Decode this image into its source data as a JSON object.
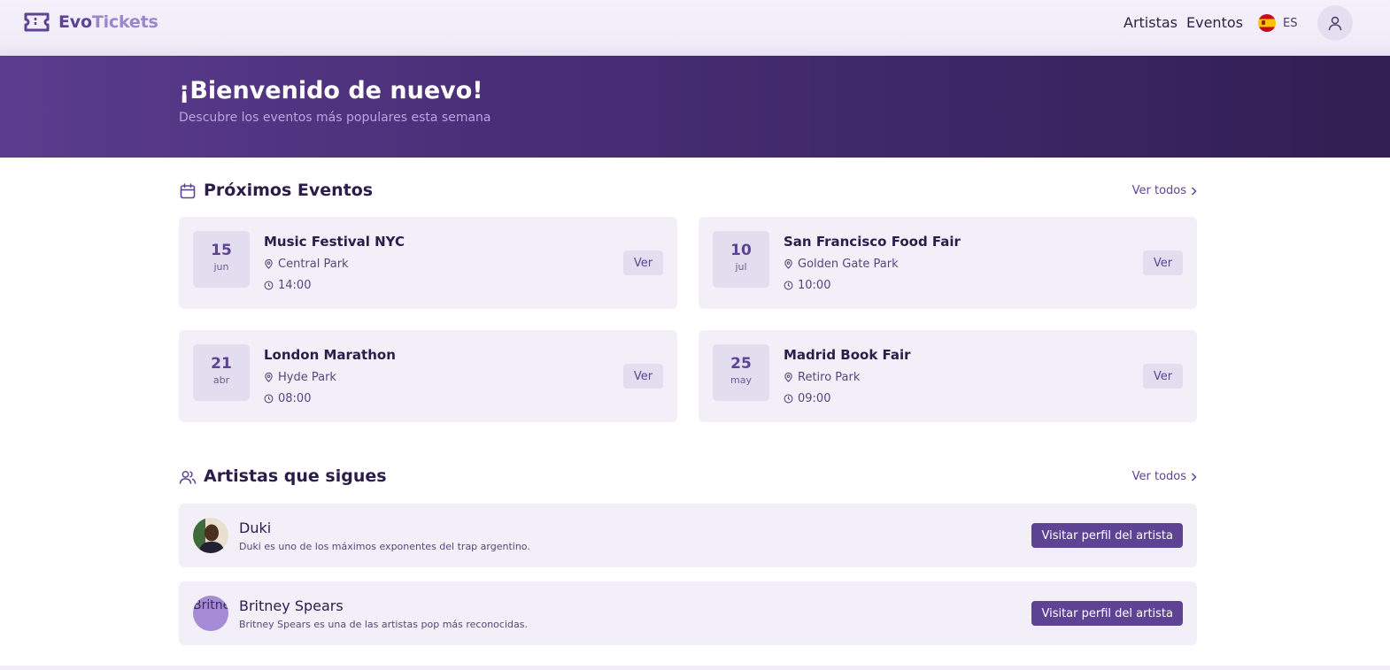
{
  "brand": {
    "name_part1": "Evo",
    "name_part2": "Tickets",
    "icon": "ticket-icon"
  },
  "nav": {
    "artists": "Artistas",
    "events": "Eventos",
    "language_code": "ES",
    "language_flag": "spain-flag-icon",
    "profile_icon": "user-icon"
  },
  "hero": {
    "title": "¡Bienvenido de nuevo!",
    "subtitle": "Descubre los eventos más populares esta semana"
  },
  "upcoming": {
    "icon": "calendar-icon",
    "title": "Próximos Eventos",
    "see_all": "Ver todos",
    "events": [
      {
        "day": "15",
        "month": "jun",
        "name": "Music Festival NYC",
        "place": "Central Park",
        "time": "14:00",
        "action": "Ver"
      },
      {
        "day": "10",
        "month": "jul",
        "name": "San Francisco Food Fair",
        "place": "Golden Gate Park",
        "time": "10:00",
        "action": "Ver"
      },
      {
        "day": "21",
        "month": "abr",
        "name": "London Marathon",
        "place": "Hyde Park",
        "time": "08:00",
        "action": "Ver"
      },
      {
        "day": "25",
        "month": "may",
        "name": "Madrid Book Fair",
        "place": "Retiro Park",
        "time": "09:00",
        "action": "Ver"
      }
    ]
  },
  "artists": {
    "icon": "users-icon",
    "title": "Artistas que sigues",
    "see_all": "Ver todos",
    "items": [
      {
        "name": "Duki",
        "description": "Duki es uno de los máximos exponentes del trap argentino.",
        "action": "Visitar perfil del artista"
      },
      {
        "name": "Britney Spears",
        "avatar_alt": "Britney Spears",
        "description": "Britney Spears es una de las artistas pop más reconocidas.",
        "action": "Visitar perfil del artista"
      }
    ]
  },
  "colors": {
    "accent": "#5e4394",
    "hero_start": "#5b3c8e",
    "hero_end": "#321e52",
    "card_bg": "#f2eff9"
  }
}
